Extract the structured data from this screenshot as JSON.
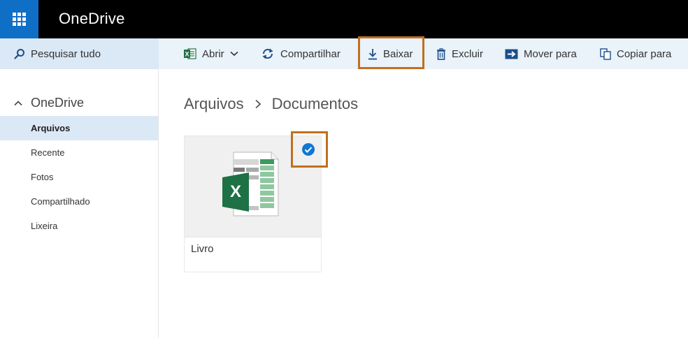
{
  "header": {
    "app_name": "OneDrive"
  },
  "icons": {
    "waffle": "app-launcher-icon",
    "search": "search-icon",
    "excel": "excel-icon",
    "share": "share-icon",
    "download": "download-icon",
    "delete": "trash-icon",
    "move": "move-icon",
    "copy": "copy-icon"
  },
  "colors": {
    "accent": "#0f6fc6",
    "highlight": "#c0701f",
    "command_bar": "#eaf2fa",
    "selected_nav": "#dbe8f5",
    "excel_green": "#1e7145"
  },
  "search": {
    "label": "Pesquisar tudo"
  },
  "toolbar": {
    "open_label": "Abrir",
    "share_label": "Compartilhar",
    "download_label": "Baixar",
    "delete_label": "Excluir",
    "move_label": "Mover para",
    "copy_label": "Copiar para"
  },
  "sidebar": {
    "root_label": "OneDrive",
    "items": [
      {
        "label": "Arquivos",
        "active": true
      },
      {
        "label": "Recente"
      },
      {
        "label": "Fotos"
      },
      {
        "label": "Compartilhado"
      },
      {
        "label": "Lixeira"
      }
    ]
  },
  "breadcrumb": {
    "parent": "Arquivos",
    "current": "Documentos"
  },
  "files": [
    {
      "name": "Livro",
      "type": "excel",
      "selected": true
    }
  ]
}
